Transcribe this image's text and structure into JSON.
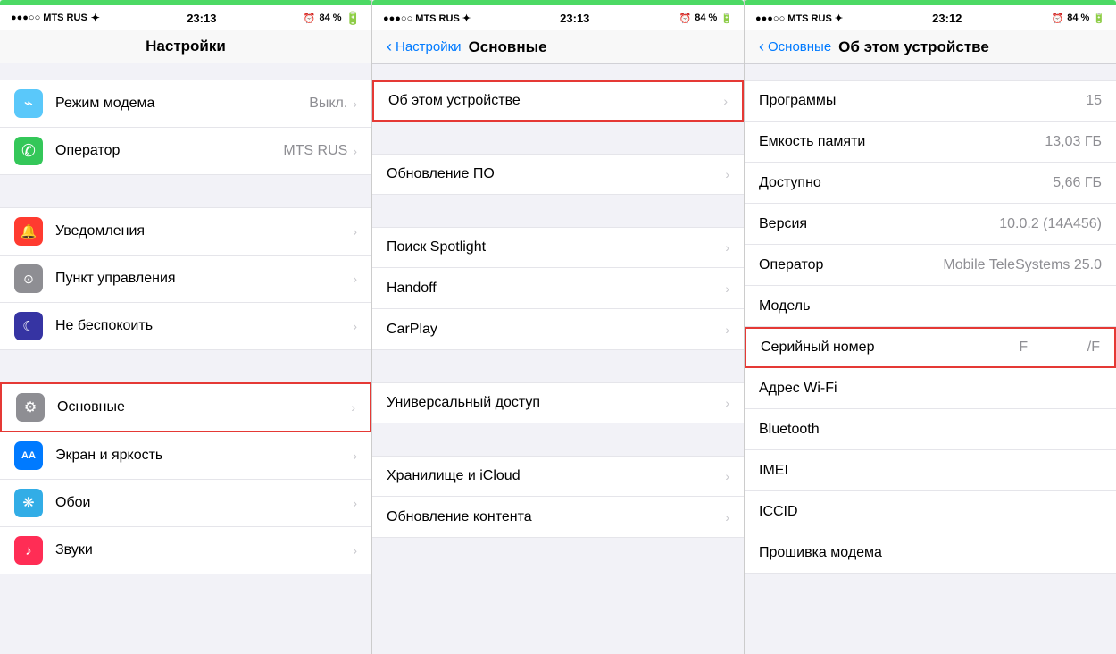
{
  "panels": [
    {
      "id": "panel1",
      "statusBar": {
        "left": "●●●○○ MTS RUS ✦",
        "time": "23:13",
        "battery": "84 %"
      },
      "navTitle": "Настройки",
      "hasBack": false,
      "sections": [
        {
          "rows": [
            {
              "icon": "icon-teal",
              "iconChar": "⌁",
              "label": "Режим модема",
              "value": "Выкл.",
              "chevron": true
            },
            {
              "icon": "icon-green2",
              "iconChar": "✆",
              "label": "Оператор",
              "value": "MTS RUS",
              "chevron": true
            }
          ]
        },
        {
          "rows": [
            {
              "icon": "icon-red",
              "iconChar": "🔔",
              "label": "Уведомления",
              "value": "",
              "chevron": true
            },
            {
              "icon": "icon-gray",
              "iconChar": "⊙",
              "label": "Пункт управления",
              "value": "",
              "chevron": true
            },
            {
              "icon": "icon-indigo",
              "iconChar": "☾",
              "label": "Не беспокоить",
              "value": "",
              "chevron": true
            }
          ]
        },
        {
          "rows": [
            {
              "icon": "icon-gray",
              "iconChar": "⚙",
              "label": "Основные",
              "value": "",
              "chevron": true,
              "highlighted": true
            },
            {
              "icon": "icon-blue",
              "iconChar": "AA",
              "label": "Экран и яркость",
              "value": "",
              "chevron": true
            },
            {
              "icon": "icon-teal2",
              "iconChar": "❋",
              "label": "Обои",
              "value": "",
              "chevron": true
            },
            {
              "icon": "icon-pink",
              "iconChar": "♪",
              "label": "Звуки",
              "value": "",
              "chevron": true
            }
          ]
        }
      ]
    },
    {
      "id": "panel2",
      "statusBar": {
        "left": "●●●○○ MTS RUS ✦",
        "time": "23:13",
        "battery": "84 %"
      },
      "hasBack": true,
      "backLabel": "Настройки",
      "currentTitle": "Основные",
      "sections": [
        {
          "rows": [
            {
              "label": "Об этом устройстве",
              "value": "",
              "chevron": true,
              "highlighted": true
            }
          ]
        },
        {
          "rows": [
            {
              "label": "Обновление ПО",
              "value": "",
              "chevron": true
            }
          ]
        },
        {
          "rows": [
            {
              "label": "Поиск Spotlight",
              "value": "",
              "chevron": true
            },
            {
              "label": "Handoff",
              "value": "",
              "chevron": true
            },
            {
              "label": "CarPlay",
              "value": "",
              "chevron": true
            }
          ]
        },
        {
          "rows": [
            {
              "label": "Универсальный доступ",
              "value": "",
              "chevron": true
            }
          ]
        },
        {
          "rows": [
            {
              "label": "Хранилище и iCloud",
              "value": "",
              "chevron": true
            },
            {
              "label": "Обновление контента",
              "value": "",
              "chevron": true
            }
          ]
        }
      ]
    },
    {
      "id": "panel3",
      "statusBar": {
        "left": "●●●○○ MTS RUS ✦",
        "time": "23:12",
        "battery": "84 %"
      },
      "hasBack": true,
      "backLabel": "Основные",
      "currentTitle": "Об этом устройстве",
      "infoRows": [
        {
          "label": "Программы",
          "value": "15"
        },
        {
          "label": "Емкость памяти",
          "value": "13,03 ГБ"
        },
        {
          "label": "Доступно",
          "value": "5,66 ГБ"
        },
        {
          "label": "Версия",
          "value": "10.0.2 (14A456)"
        },
        {
          "label": "Оператор",
          "value": "Mobile TeleSystems 25.0"
        },
        {
          "label": "Модель",
          "value": ""
        },
        {
          "label": "Серийный номер",
          "value": "F                /F",
          "highlighted": true
        },
        {
          "label": "Адрес Wi-Fi",
          "value": ""
        },
        {
          "label": "Bluetooth",
          "value": ""
        },
        {
          "label": "IMEI",
          "value": ""
        },
        {
          "label": "ICCID",
          "value": ""
        },
        {
          "label": "Прошивка модема",
          "value": ""
        }
      ]
    }
  ]
}
